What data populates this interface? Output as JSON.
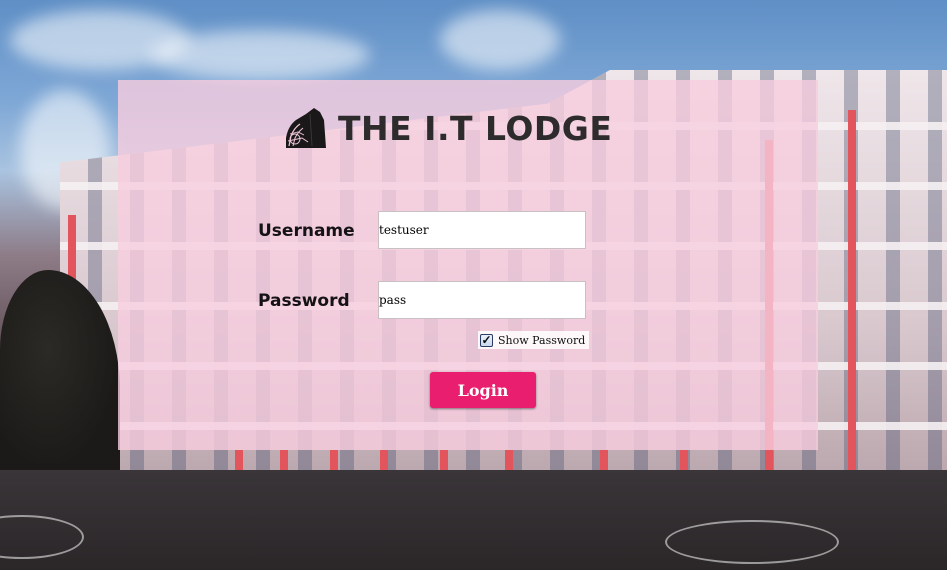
{
  "header": {
    "title": "THE I.T LODGE",
    "logo_icon": "hill-building-logo-icon"
  },
  "form": {
    "username": {
      "label": "Username",
      "value": "testuser"
    },
    "password": {
      "label": "Password",
      "value": "pass"
    },
    "show_password": {
      "label": "Show Password",
      "checked": true
    },
    "login_button": {
      "label": "Login"
    }
  },
  "colors": {
    "panel_background": "#f8cdde",
    "login_button": "#e91e6e",
    "title_text": "#2d2b2c"
  }
}
